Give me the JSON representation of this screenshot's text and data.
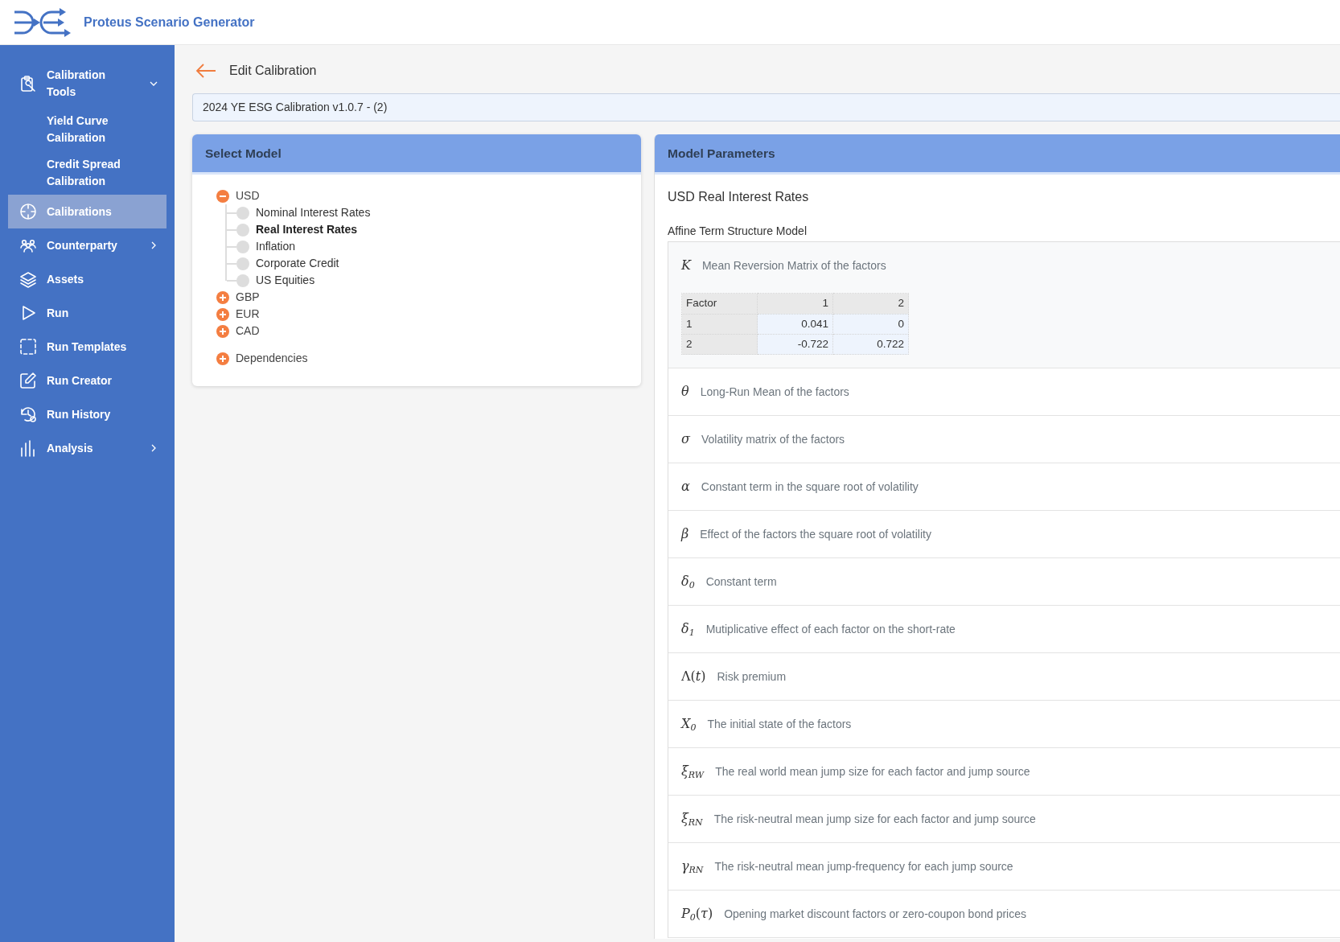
{
  "app": {
    "title": "Proteus Scenario Generator"
  },
  "sidebar": {
    "items": [
      {
        "label": "Calibration Tools",
        "selected": false,
        "expanded": true,
        "children": [
          {
            "label": "Yield Curve Calibration",
            "selected": false
          },
          {
            "label": "Credit Spread Calibration",
            "selected": false
          }
        ]
      },
      {
        "label": "Calibrations",
        "selected": true
      },
      {
        "label": "Counterparty",
        "selected": false,
        "expanded": false
      },
      {
        "label": "Assets",
        "selected": false
      },
      {
        "label": "Run",
        "selected": false
      },
      {
        "label": "Run Templates",
        "selected": false
      },
      {
        "label": "Run Creator",
        "selected": false
      },
      {
        "label": "Run History",
        "selected": false
      },
      {
        "label": "Analysis",
        "selected": false,
        "expanded": false
      }
    ]
  },
  "page": {
    "title": "Edit Calibration",
    "calibration_name": "2024 YE ESG Calibration v1.0.7 - (2)"
  },
  "select_model": {
    "title": "Select Model",
    "tree": [
      {
        "label": "USD",
        "expanded": true,
        "children": [
          {
            "label": "Nominal Interest Rates",
            "selected": false
          },
          {
            "label": "Real Interest Rates",
            "selected": true
          },
          {
            "label": "Inflation",
            "selected": false
          },
          {
            "label": "Corporate Credit",
            "selected": false
          },
          {
            "label": "US Equities",
            "selected": false
          }
        ]
      },
      {
        "label": "GBP",
        "expanded": false
      },
      {
        "label": "EUR",
        "expanded": false
      },
      {
        "label": "CAD",
        "expanded": false
      }
    ],
    "dependencies": {
      "label": "Dependencies",
      "expanded": false
    }
  },
  "model_parameters": {
    "title": "Model Parameters",
    "model_name": "USD Real Interest Rates",
    "model_type": "Affine Term Structure Model",
    "parameters": [
      {
        "symbol": "*K*",
        "description": "Mean Reversion Matrix of the factors",
        "expanded": true,
        "matrix": {
          "columns": [
            "Factor",
            "1",
            "2"
          ],
          "rows": [
            [
              "1",
              "0.041",
              "0"
            ],
            [
              "2",
              "-0.722",
              "0.722"
            ]
          ]
        }
      },
      {
        "symbol": "*θ*",
        "description": "Long-Run Mean of the factors",
        "expanded": false
      },
      {
        "symbol": "*σ*",
        "description": "Volatility matrix of the factors",
        "expanded": false
      },
      {
        "symbol": "*α*",
        "description": "Constant term in the square root of volatility",
        "expanded": false
      },
      {
        "symbol": "*β*",
        "description": "Effect of the factors the square root of volatility",
        "expanded": false
      },
      {
        "symbol": "*δ*$_{0}$",
        "description": "Constant term",
        "expanded": false
      },
      {
        "symbol": "*δ*$_{1}$",
        "description": "Mutiplicative effect of each factor on the short-rate",
        "expanded": false
      },
      {
        "symbol": "Λ(*t*)",
        "description": "Risk premium",
        "expanded": false
      },
      {
        "symbol": "*X*$_{0}$",
        "description": "The initial state of the factors",
        "expanded": false
      },
      {
        "symbol": "*ξ*$_{RW}$",
        "description": "The real world mean jump size for each factor and jump source",
        "expanded": false
      },
      {
        "symbol": "*ξ*$_{RN}$",
        "description": "The risk-neutral mean jump size for each factor and jump source",
        "expanded": false
      },
      {
        "symbol": "*γ*$_{RN}$",
        "description": "The risk-neutral mean jump-frequency for each jump source",
        "expanded": false
      },
      {
        "symbol": "*P*$_{0}$(*τ*)",
        "description": "Opening market discount factors or zero-coupon bond prices",
        "expanded": false
      }
    ]
  }
}
